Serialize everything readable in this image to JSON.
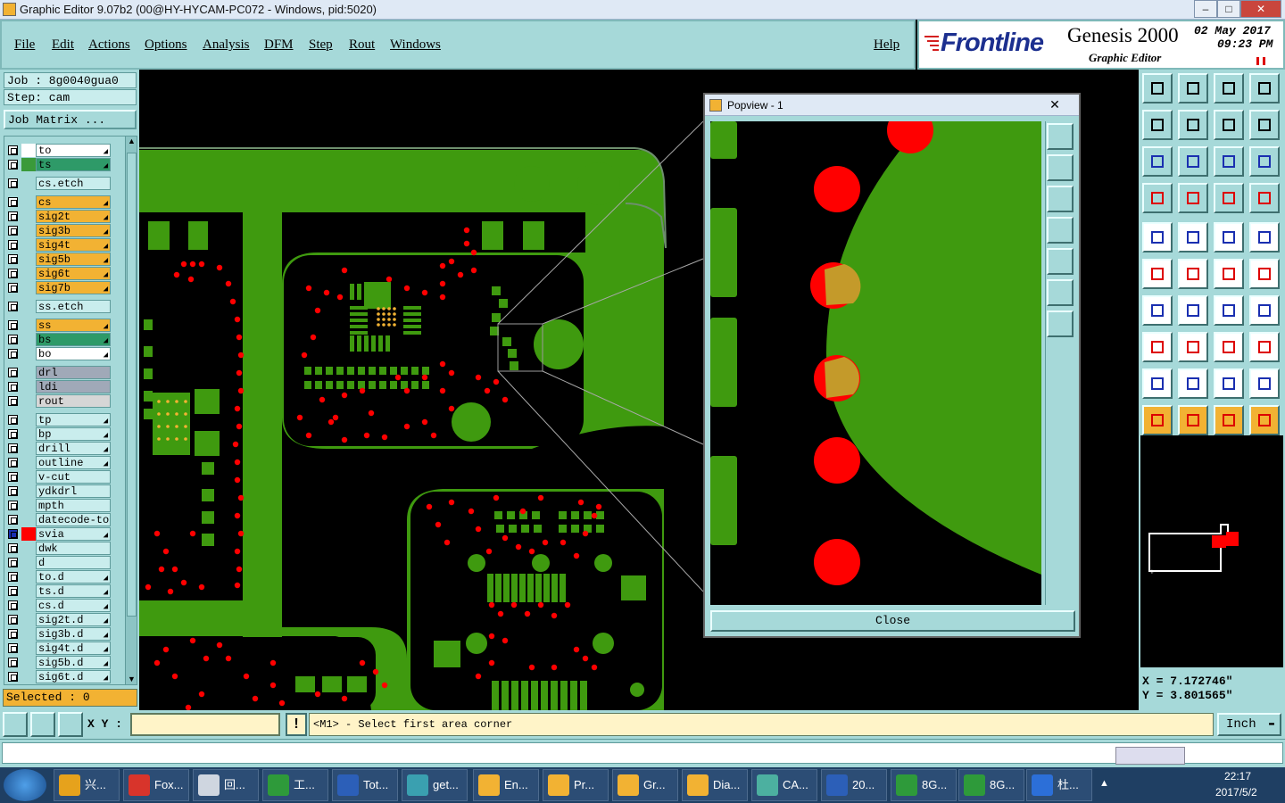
{
  "window": {
    "title": "Graphic Editor 9.07b2 (00@HY-HYCAM-PC072 - Windows, pid:5020)"
  },
  "menu": {
    "items": [
      "File",
      "Edit",
      "Actions",
      "Options",
      "Analysis",
      "DFM",
      "Step",
      "Rout",
      "Windows"
    ],
    "help": "Help"
  },
  "brand": {
    "logo": "Frontline",
    "product": "Genesis 2000",
    "subtitle": "Graphic Editor",
    "date": "02 May 2017",
    "time": "09:23 PM"
  },
  "job": {
    "job": "Job : 8g0040gua0",
    "step": "Step: cam",
    "matrix_button": "Job Matrix ..."
  },
  "layers": [
    {
      "name": "to",
      "color": "#ffffff",
      "swatch": "#ffffff",
      "arrow": true
    },
    {
      "name": "ts",
      "color": "#2e9a68",
      "swatch": "#3a9a3a",
      "arrow": true
    },
    {
      "name": "cs.etch",
      "color": "#c9eded",
      "swatch": "",
      "arrow": false,
      "gap": true
    },
    {
      "name": "cs",
      "color": "#f2b233",
      "swatch": "",
      "arrow": true,
      "gap": true
    },
    {
      "name": "sig2t",
      "color": "#f2b233",
      "swatch": "",
      "arrow": true
    },
    {
      "name": "sig3b",
      "color": "#f2b233",
      "swatch": "",
      "arrow": true
    },
    {
      "name": "sig4t",
      "color": "#f2b233",
      "swatch": "",
      "arrow": true
    },
    {
      "name": "sig5b",
      "color": "#f2b233",
      "swatch": "",
      "arrow": true
    },
    {
      "name": "sig6t",
      "color": "#f2b233",
      "swatch": "",
      "arrow": true
    },
    {
      "name": "sig7b",
      "color": "#f2b233",
      "swatch": "",
      "arrow": true
    },
    {
      "name": "ss.etch",
      "color": "#c9eded",
      "swatch": "",
      "arrow": false,
      "gap": true
    },
    {
      "name": "ss",
      "color": "#f2b233",
      "swatch": "",
      "arrow": true,
      "gap": true
    },
    {
      "name": "bs",
      "color": "#2e9a68",
      "swatch": "",
      "arrow": true
    },
    {
      "name": "bo",
      "color": "#ffffff",
      "swatch": "",
      "arrow": true
    },
    {
      "name": "drl",
      "color": "#a0a9b8",
      "swatch": "",
      "arrow": false,
      "gap": true
    },
    {
      "name": "ldi",
      "color": "#a0a9b8",
      "swatch": "",
      "arrow": false
    },
    {
      "name": "rout",
      "color": "#d6d6d6",
      "swatch": "",
      "arrow": false
    },
    {
      "name": "tp",
      "color": "#c9eded",
      "swatch": "",
      "arrow": true,
      "gap": true
    },
    {
      "name": "bp",
      "color": "#c9eded",
      "swatch": "",
      "arrow": true
    },
    {
      "name": "drill",
      "color": "#c9eded",
      "swatch": "",
      "arrow": true
    },
    {
      "name": "outline",
      "color": "#c9eded",
      "swatch": "",
      "arrow": true
    },
    {
      "name": "v-cut",
      "color": "#c9eded",
      "swatch": "",
      "arrow": false
    },
    {
      "name": "ydkdrl",
      "color": "#c9eded",
      "swatch": "",
      "arrow": false
    },
    {
      "name": "mpth",
      "color": "#c9eded",
      "swatch": "",
      "arrow": false
    },
    {
      "name": "datecode-to",
      "color": "#c9eded",
      "swatch": "",
      "arrow": false
    },
    {
      "name": "svia",
      "color": "#c9eded",
      "swatch": "#ff0000",
      "arrow": true,
      "active": true
    },
    {
      "name": "dwk",
      "color": "#c9eded",
      "swatch": "",
      "arrow": false
    },
    {
      "name": "d",
      "color": "#c9eded",
      "swatch": "",
      "arrow": false
    },
    {
      "name": "to.d",
      "color": "#c9eded",
      "swatch": "",
      "arrow": true
    },
    {
      "name": "ts.d",
      "color": "#c9eded",
      "swatch": "",
      "arrow": true
    },
    {
      "name": "cs.d",
      "color": "#c9eded",
      "swatch": "",
      "arrow": true
    },
    {
      "name": "sig2t.d",
      "color": "#c9eded",
      "swatch": "",
      "arrow": true
    },
    {
      "name": "sig3b.d",
      "color": "#c9eded",
      "swatch": "",
      "arrow": true
    },
    {
      "name": "sig4t.d",
      "color": "#c9eded",
      "swatch": "",
      "arrow": true
    },
    {
      "name": "sig5b.d",
      "color": "#c9eded",
      "swatch": "",
      "arrow": true
    },
    {
      "name": "sig6t.d",
      "color": "#c9eded",
      "swatch": "",
      "arrow": true
    }
  ],
  "selected": "Selected : 0",
  "popview": {
    "title": "Popview - 1",
    "close": "Close"
  },
  "coords": {
    "x": "X = 7.172746\"",
    "y": "Y = 3.801565\""
  },
  "bottom": {
    "xy_label": "X Y :",
    "xy_value": "",
    "prompt": "<M1> - Select first area corner",
    "units": "Inch"
  },
  "colors": {
    "board": "#3f9a0f",
    "via": "#ff0000",
    "panel": "#a6d9d9",
    "accent": "#f2b233"
  },
  "taskbar": {
    "tasks": [
      "兴...",
      "Fox...",
      "回...",
      "工...",
      "Tot...",
      "get...",
      "En...",
      "Pr...",
      "Gr...",
      "Dia...",
      "CA...",
      "20...",
      "8G...",
      "8G...",
      "杜..."
    ],
    "time": "22:17",
    "date": "2017/5/2"
  }
}
